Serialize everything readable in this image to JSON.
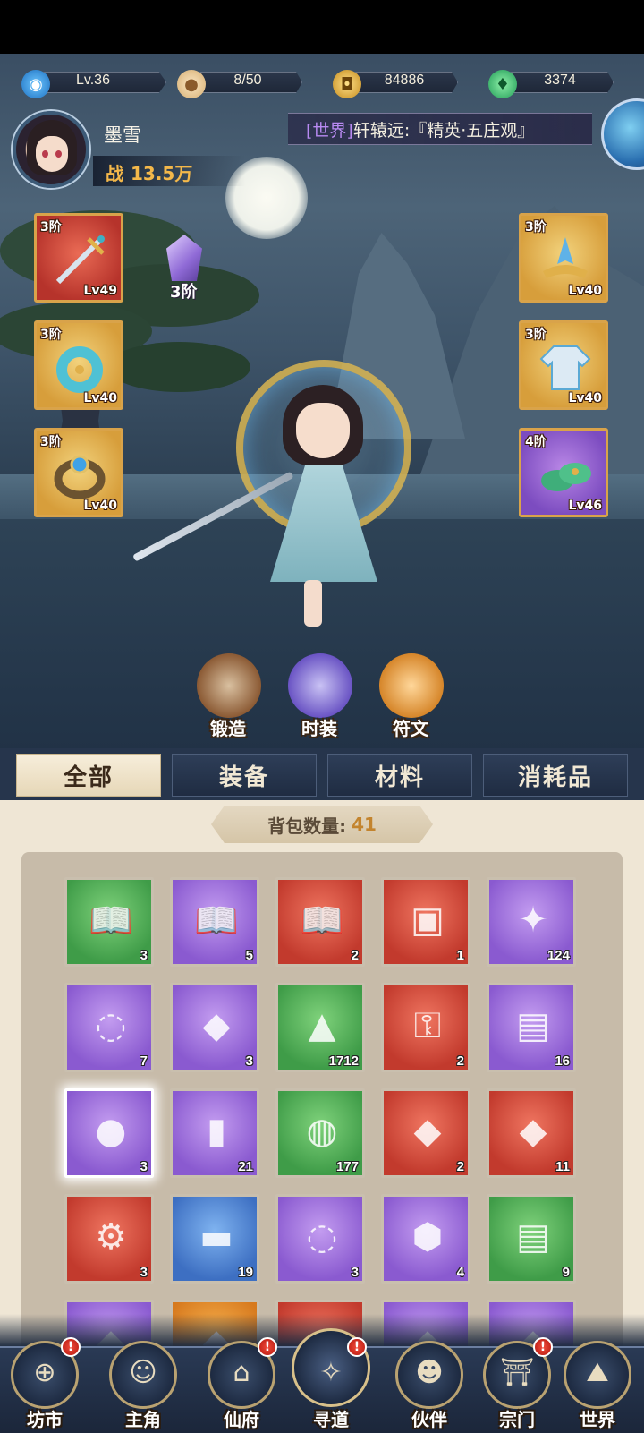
{
  "resources": [
    {
      "icon": "level-icon",
      "value": "Lv.36",
      "color": "#3fa0e6"
    },
    {
      "icon": "stamina-bun-icon",
      "value": "8/50",
      "color": "#e6c88a"
    },
    {
      "icon": "gold-coin-icon",
      "value": "84886",
      "color": "#e8b43a"
    },
    {
      "icon": "jade-leaf-icon",
      "value": "3374",
      "color": "#46c87a"
    }
  ],
  "player": {
    "name": "墨雪",
    "power_label": "战",
    "power_value": "13.5万"
  },
  "chat": {
    "channel": "[世界]",
    "message": "轩辕远:『精英·五庄观』"
  },
  "equipment": {
    "left": [
      {
        "tier": "3阶",
        "level": "Lv49",
        "icon": "sword-icon",
        "rarity": "red"
      },
      {
        "tier": "3阶",
        "level": "Lv40",
        "icon": "jade-pendant-icon",
        "rarity": "gold"
      },
      {
        "tier": "3阶",
        "level": "Lv40",
        "icon": "ring-icon",
        "rarity": "gold"
      }
    ],
    "right": [
      {
        "tier": "3阶",
        "level": "Lv40",
        "icon": "crown-icon",
        "rarity": "gold"
      },
      {
        "tier": "3阶",
        "level": "Lv40",
        "icon": "robe-icon",
        "rarity": "gold"
      },
      {
        "tier": "4阶",
        "level": "Lv46",
        "icon": "boots-icon",
        "rarity": "purple"
      }
    ],
    "gem": {
      "tier": "3阶",
      "icon": "purple-crystal-icon"
    }
  },
  "actions": [
    {
      "label": "锻造",
      "icon": "hammer-icon",
      "color": "#a0643a"
    },
    {
      "label": "时装",
      "icon": "outfit-icon",
      "color": "#7a66d4"
    },
    {
      "label": "符文",
      "icon": "rune-icon",
      "color": "#e6963a"
    }
  ],
  "tabs": [
    "全部",
    "装备",
    "材料",
    "消耗品"
  ],
  "active_tab": 0,
  "bag": {
    "count_label": "背包数量:",
    "count_value": "41",
    "items": [
      {
        "icon": "book-icon",
        "qty": "3",
        "rarity": "green"
      },
      {
        "icon": "book-icon",
        "qty": "5",
        "rarity": "purple"
      },
      {
        "icon": "book-icon",
        "qty": "2",
        "rarity": "red"
      },
      {
        "icon": "treasure-chest-icon",
        "qty": "1",
        "rarity": "red"
      },
      {
        "icon": "ice-crystal-icon",
        "qty": "124",
        "rarity": "purple"
      },
      {
        "icon": "cloud-swirl-icon",
        "qty": "7",
        "rarity": "purple"
      },
      {
        "icon": "puzzle-piece-icon",
        "qty": "3",
        "rarity": "purple"
      },
      {
        "icon": "ore-rock-icon",
        "qty": "1712",
        "rarity": "green"
      },
      {
        "icon": "golden-key-icon",
        "qty": "2",
        "rarity": "red"
      },
      {
        "icon": "scroll-map-icon",
        "qty": "16",
        "rarity": "purple"
      },
      {
        "icon": "peach-icon",
        "qty": "3",
        "rarity": "purple",
        "selected": true
      },
      {
        "icon": "jade-scroll-icon",
        "qty": "21",
        "rarity": "purple"
      },
      {
        "icon": "green-orb-icon",
        "qty": "177",
        "rarity": "green"
      },
      {
        "icon": "red-puzzle-icon",
        "qty": "2",
        "rarity": "red"
      },
      {
        "icon": "red-puzzle-icon",
        "qty": "11",
        "rarity": "red"
      },
      {
        "icon": "gear-icon",
        "qty": "3",
        "rarity": "red"
      },
      {
        "icon": "wood-log-icon",
        "qty": "19",
        "rarity": "blue"
      },
      {
        "icon": "golden-swirl-icon",
        "qty": "3",
        "rarity": "purple"
      },
      {
        "icon": "purple-stone-icon",
        "qty": "4",
        "rarity": "purple"
      },
      {
        "icon": "paper-scroll-icon",
        "qty": "9",
        "rarity": "green"
      },
      {
        "icon": "item-icon",
        "qty": "",
        "rarity": "purple"
      },
      {
        "icon": "item-icon",
        "qty": "",
        "rarity": "orange"
      },
      {
        "icon": "item-icon",
        "qty": "",
        "rarity": "red"
      },
      {
        "icon": "item-icon",
        "qty": "",
        "rarity": "purple"
      },
      {
        "icon": "item-icon",
        "qty": "",
        "rarity": "purple"
      }
    ]
  },
  "nav": [
    {
      "label": "坊市",
      "icon": "market-icon",
      "badge": "!"
    },
    {
      "label": "主角",
      "icon": "hero-icon",
      "badge": ""
    },
    {
      "label": "仙府",
      "icon": "mansion-icon",
      "badge": "!"
    },
    {
      "label": "寻道",
      "icon": "quest-icon",
      "badge": "!"
    },
    {
      "label": "伙伴",
      "icon": "partner-icon",
      "badge": ""
    },
    {
      "label": "宗门",
      "icon": "sect-icon",
      "badge": "!"
    },
    {
      "label": "世界",
      "icon": "world-icon",
      "badge": ""
    }
  ]
}
